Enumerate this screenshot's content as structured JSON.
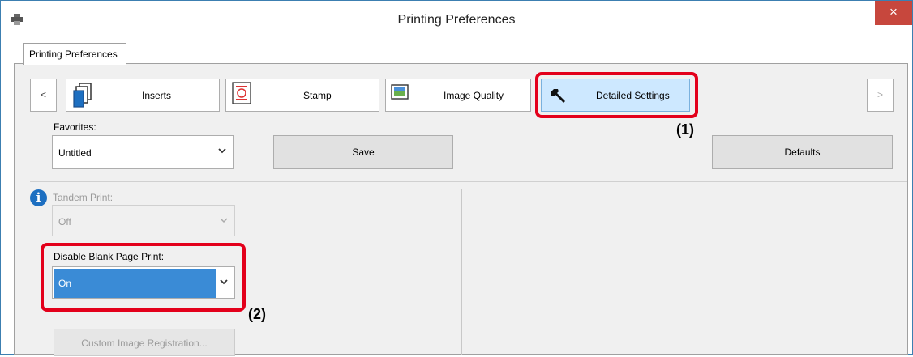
{
  "window": {
    "title": "Printing Preferences",
    "close": "×"
  },
  "tab": {
    "label": "Printing Preferences"
  },
  "toolbar": {
    "prev": "<",
    "next": ">",
    "items": [
      {
        "label": "Inserts",
        "icon": "inserts-icon"
      },
      {
        "label": "Stamp",
        "icon": "stamp-icon"
      },
      {
        "label": "Image Quality",
        "icon": "image-quality-icon"
      },
      {
        "label": "Detailed Settings",
        "icon": "wrench-icon",
        "active": true
      }
    ]
  },
  "favorites": {
    "label": "Favorites:",
    "value": "Untitled",
    "save": "Save",
    "defaults": "Defaults"
  },
  "tandem": {
    "label": "Tandem Print:",
    "value": "Off"
  },
  "blank_page": {
    "label": "Disable Blank Page Print:",
    "value": "On"
  },
  "custom_image": {
    "label": "Custom Image Registration..."
  },
  "callouts": {
    "one": "(1)",
    "two": "(2)"
  },
  "colors": {
    "highlight": "#e3001b",
    "selection": "#3a8bd6",
    "close": "#c7473d"
  }
}
